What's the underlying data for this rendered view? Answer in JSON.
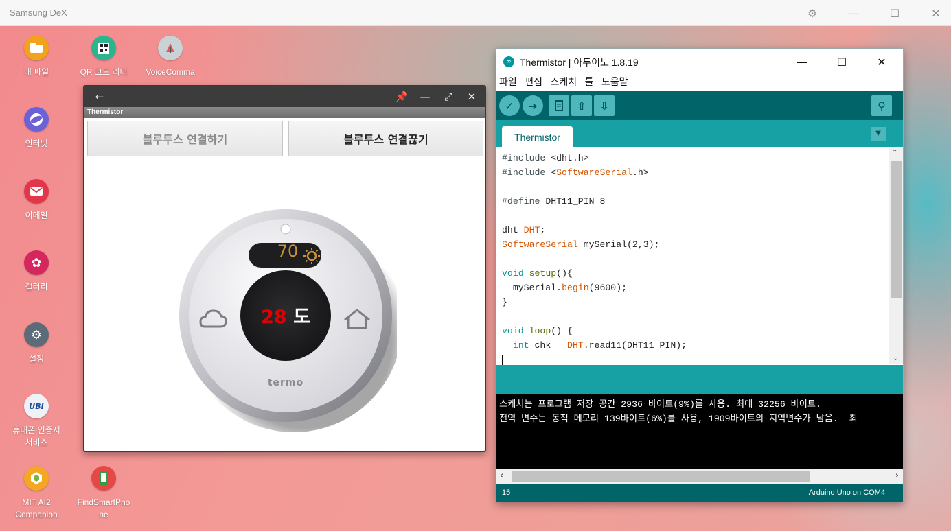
{
  "dex": {
    "title": "Samsung DeX"
  },
  "desktop_icons": [
    {
      "label": "내 파일",
      "icon": "folder-icon",
      "color": "#f3a21c"
    },
    {
      "label": "QR 코드 리더",
      "icon": "qr-code-icon",
      "color": "#2bb48d"
    },
    {
      "label": "VoiceComma\nnd",
      "icon": "voice-command-icon",
      "color": "#c9d3d6"
    },
    {
      "label": "인터넷",
      "icon": "internet-icon",
      "color": "#6c62d8"
    },
    {
      "label": "이메일",
      "icon": "email-icon",
      "color": "#e2374a"
    },
    {
      "label": "갤러리",
      "icon": "gallery-icon",
      "color": "#d6265e"
    },
    {
      "label": "설정",
      "icon": "settings-icon",
      "color": "#5b6b78"
    },
    {
      "label": "휴대폰 인증서\n서비스",
      "icon": "ubikey-icon",
      "color": "#eef2f7"
    },
    {
      "label": "MIT AI2\nCompanion",
      "icon": "mit-ai2-icon",
      "color": "#f5a623"
    },
    {
      "label": "FindSmartPho\nne",
      "icon": "find-phone-icon",
      "color": "#e64848"
    }
  ],
  "app_window": {
    "subtitle": "Thermistor",
    "connect_button": "블루투스 연결하기",
    "disconnect_button": "블루투스 연결끊기",
    "thermostat": {
      "set_temp": "70",
      "current_temp": "28",
      "unit": "도",
      "brand": "termo",
      "accent_color": "#e00000",
      "setpoint_color": "#c9933a"
    }
  },
  "arduino": {
    "title": "Thermistor | 아두이노 1.8.19",
    "menu": [
      "파일",
      "편집",
      "스케치",
      "툴",
      "도움말"
    ],
    "tab": "Thermistor",
    "code": [
      [
        {
          "t": "#include",
          "c": "kw4"
        },
        {
          "t": " <dht.h>",
          "c": ""
        }
      ],
      [
        {
          "t": "#include",
          "c": "kw4"
        },
        {
          "t": " <",
          "c": ""
        },
        {
          "t": "SoftwareSerial",
          "c": "kw2"
        },
        {
          "t": ".h>",
          "c": ""
        }
      ],
      [
        {
          "t": "",
          "c": ""
        }
      ],
      [
        {
          "t": "#define",
          "c": "kw4"
        },
        {
          "t": " DHT11_PIN 8",
          "c": ""
        }
      ],
      [
        {
          "t": "",
          "c": ""
        }
      ],
      [
        {
          "t": "dht ",
          "c": ""
        },
        {
          "t": "DHT",
          "c": "kw2"
        },
        {
          "t": ";",
          "c": ""
        }
      ],
      [
        {
          "t": "SoftwareSerial",
          "c": "kw2"
        },
        {
          "t": " mySerial(2,3);",
          "c": ""
        }
      ],
      [
        {
          "t": "",
          "c": ""
        }
      ],
      [
        {
          "t": "void",
          "c": "kw3"
        },
        {
          "t": " ",
          "c": ""
        },
        {
          "t": "setup",
          "c": "kw1"
        },
        {
          "t": "(){",
          "c": ""
        }
      ],
      [
        {
          "t": "  mySerial.",
          "c": ""
        },
        {
          "t": "begin",
          "c": "kw2"
        },
        {
          "t": "(9600);",
          "c": ""
        }
      ],
      [
        {
          "t": "}",
          "c": ""
        }
      ],
      [
        {
          "t": "",
          "c": ""
        }
      ],
      [
        {
          "t": "void",
          "c": "kw3"
        },
        {
          "t": " ",
          "c": ""
        },
        {
          "t": "loop",
          "c": "kw1"
        },
        {
          "t": "() {",
          "c": ""
        }
      ],
      [
        {
          "t": "  ",
          "c": ""
        },
        {
          "t": "int",
          "c": "kw3"
        },
        {
          "t": " chk = ",
          "c": ""
        },
        {
          "t": "DHT",
          "c": "kw2"
        },
        {
          "t": ".read11(DHT11_PIN);",
          "c": ""
        }
      ]
    ],
    "console": [
      "스케치는 프로그램 저장 공간 2936 바이트(9%)를 사용. 최대 32256 바이트.",
      "전역 변수는 동적 메모리 139바이트(6%)를 사용, 1909바이트의 지역변수가 남음.  최"
    ],
    "line_number": "15",
    "board": "Arduino Uno on COM4"
  }
}
